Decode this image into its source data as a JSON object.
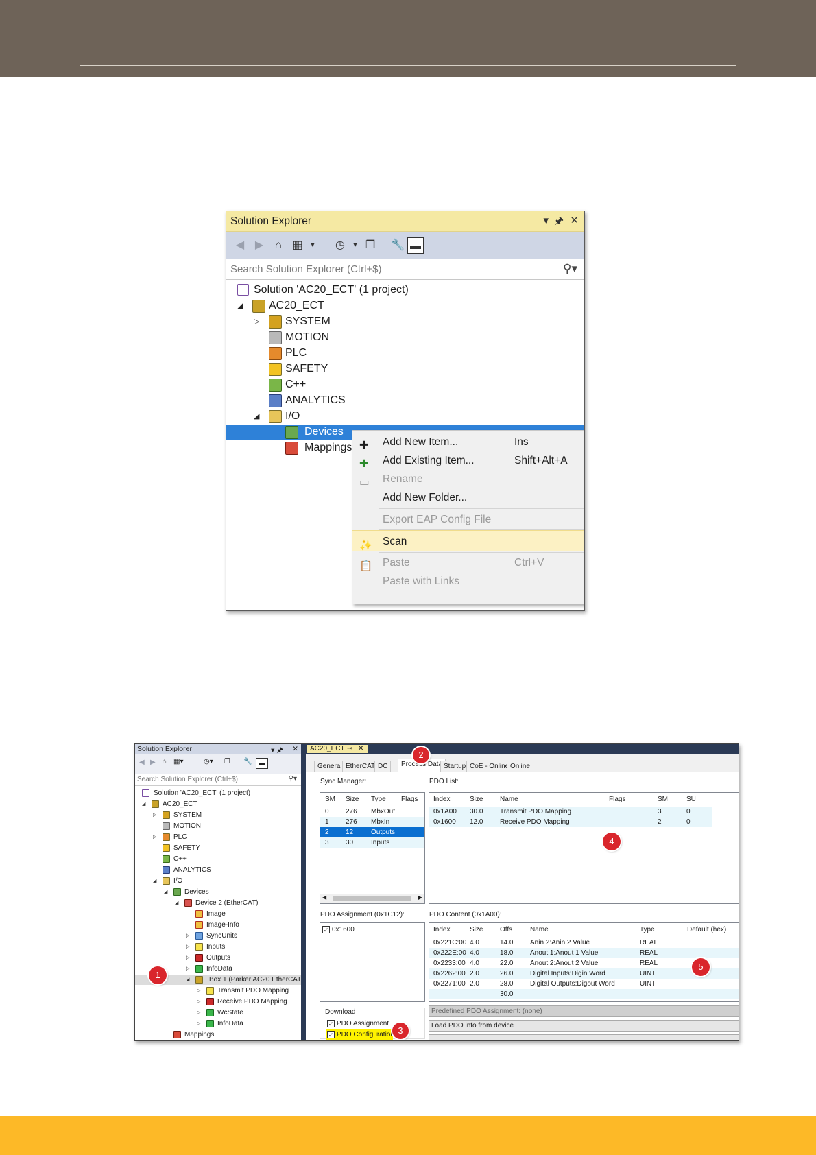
{
  "colors": {
    "header_band": "#6e6358",
    "footer_band": "#fdb927",
    "vs_title": "#f5e9a3",
    "selection": "#2e81d8"
  },
  "explorer1": {
    "title": "Solution Explorer",
    "title_controls": [
      "▾",
      "🖈",
      "✕"
    ],
    "search_placeholder": "Search Solution Explorer (Ctrl+$)",
    "tree": {
      "solution": "Solution 'AC20_ECT' (1 project)",
      "project": "AC20_ECT",
      "system": "SYSTEM",
      "motion": "MOTION",
      "plc": "PLC",
      "safety": "SAFETY",
      "cpp": "C++",
      "analytics": "ANALYTICS",
      "io": "I/O",
      "devices": "Devices",
      "mappings": "Mappings"
    },
    "context_menu": {
      "add_new_item": {
        "label": "Add New Item...",
        "shortcut": "Ins"
      },
      "add_existing_item": {
        "label": "Add Existing Item...",
        "shortcut": "Shift+Alt+A"
      },
      "rename": {
        "label": "Rename"
      },
      "add_new_folder": {
        "label": "Add New Folder..."
      },
      "export_eap": {
        "label": "Export EAP Config File"
      },
      "scan": {
        "label": "Scan"
      },
      "paste": {
        "label": "Paste",
        "shortcut": "Ctrl+V"
      },
      "paste_links": {
        "label": "Paste with Links"
      }
    }
  },
  "explorer2": {
    "title": "Solution Explorer",
    "search_placeholder": "Search Solution Explorer (Ctrl+$)",
    "tree": {
      "solution": "Solution 'AC20_ECT' (1 project)",
      "project": "AC20_ECT",
      "system": "SYSTEM",
      "motion": "MOTION",
      "plc": "PLC",
      "safety": "SAFETY",
      "cpp": "C++",
      "analytics": "ANALYTICS",
      "io": "I/O",
      "devices": "Devices",
      "device2": "Device 2 (EtherCAT)",
      "image": "Image",
      "image_info": "Image-Info",
      "syncunits": "SyncUnits",
      "inputs": "Inputs",
      "outputs": "Outputs",
      "infodata": "InfoData",
      "box1": "Box 1 (Parker AC20 EtherCAT",
      "tx_pdo": "Transmit PDO Mapping",
      "rx_pdo": "Receive PDO Mapping",
      "wcstate": "WcState",
      "infodata2": "InfoData",
      "mappings": "Mappings"
    }
  },
  "editor": {
    "doc_tab": "AC20_ECT",
    "tabs": [
      "General",
      "EtherCAT",
      "DC",
      "Process Data",
      "Startup",
      "CoE - Online",
      "Online"
    ],
    "sync_manager": {
      "label": "Sync Manager:",
      "headers": [
        "SM",
        "Size",
        "Type",
        "Flags"
      ],
      "rows": [
        [
          "0",
          "276",
          "MbxOut",
          ""
        ],
        [
          "1",
          "276",
          "MbxIn",
          ""
        ],
        [
          "2",
          "12",
          "Outputs",
          ""
        ],
        [
          "3",
          "30",
          "Inputs",
          ""
        ]
      ]
    },
    "pdo_list": {
      "label": "PDO List:",
      "headers": [
        "Index",
        "Size",
        "Name",
        "Flags",
        "SM",
        "SU"
      ],
      "rows": [
        [
          "0x1A00",
          "30.0",
          "Transmit PDO Mapping",
          "",
          "3",
          "0"
        ],
        [
          "0x1600",
          "12.0",
          "Receive PDO Mapping",
          "",
          "2",
          "0"
        ]
      ]
    },
    "pdo_assignment": {
      "label": "PDO Assignment (0x1C12):",
      "items": [
        "0x1600"
      ]
    },
    "pdo_content": {
      "label": "PDO Content (0x1A00):",
      "headers": [
        "Index",
        "Size",
        "Offs",
        "Name",
        "Type",
        "Default (hex)"
      ],
      "rows": [
        [
          "0x221C:00",
          "4.0",
          "14.0",
          "Anin 2:Anin 2 Value",
          "REAL",
          ""
        ],
        [
          "0x222E:00",
          "4.0",
          "18.0",
          "Anout 1:Anout 1 Value",
          "REAL",
          ""
        ],
        [
          "0x2233:00",
          "4.0",
          "22.0",
          "Anout 2:Anout 2 Value",
          "REAL",
          ""
        ],
        [
          "0x2262:00",
          "2.0",
          "26.0",
          "Digital Inputs:Digin Word",
          "UINT",
          ""
        ],
        [
          "0x2271:00",
          "2.0",
          "28.0",
          "Digital Outputs:Digout Word",
          "UINT",
          ""
        ],
        [
          "",
          "",
          "30.0",
          "",
          "",
          ""
        ]
      ]
    },
    "download": {
      "label": "Download",
      "pdo_assignment": "PDO Assignment",
      "pdo_configuration": "PDO Configuration"
    },
    "predefined": "Predefined PDO Assignment: (none)",
    "load_pdo": "Load PDO info from device"
  },
  "callouts": [
    "1",
    "2",
    "3",
    "4",
    "5"
  ]
}
